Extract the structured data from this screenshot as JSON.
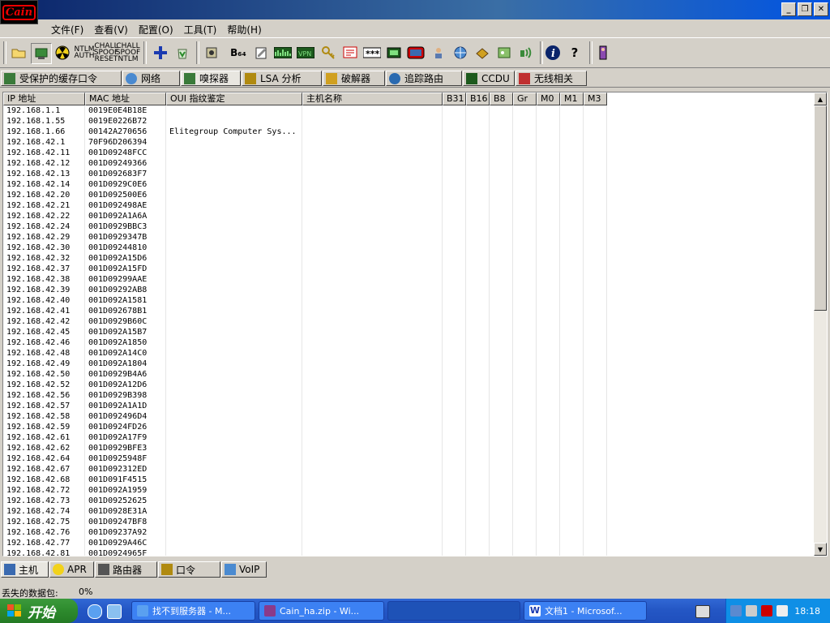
{
  "app": {
    "logo_text": "Cain"
  },
  "window_buttons": {
    "minimize": "_",
    "restore": "❐",
    "close": "✕"
  },
  "menu": [
    "文件(F)",
    "查看(V)",
    "配置(O)",
    "工具(T)",
    "帮助(H)"
  ],
  "toolbar": {
    "b64_label": "B₆₄",
    "ntlm_auth": [
      "NTLM",
      "AUTH"
    ],
    "chall_reset": [
      "CHALL",
      "SPOOF",
      "RESET"
    ],
    "chall_ntlm": [
      "CHALL",
      "SPOOF",
      "NTLM"
    ],
    "password_mask": "***",
    "help_mark": "?"
  },
  "tabs": [
    "受保护的缓存口令",
    "网络",
    "嗅探器",
    "LSA 分析",
    "破解器",
    "追踪路由",
    "CCDU",
    "无线相关"
  ],
  "columns": [
    "IP 地址",
    "MAC 地址",
    "OUI 指纹鉴定",
    "主机名称",
    "B31",
    "B16",
    "B8",
    "Gr",
    "M0",
    "M1",
    "M3"
  ],
  "rows": [
    {
      "ip": "192.168.1.1",
      "mac": "0019E0E4B18E",
      "oui": ""
    },
    {
      "ip": "192.168.1.55",
      "mac": "0019E0226B72",
      "oui": ""
    },
    {
      "ip": "192.168.1.66",
      "mac": "00142A270656",
      "oui": "Elitegroup Computer Sys..."
    },
    {
      "ip": "192.168.42.1",
      "mac": "70F96D206394",
      "oui": ""
    },
    {
      "ip": "192.168.42.11",
      "mac": "001D09248FCC",
      "oui": ""
    },
    {
      "ip": "192.168.42.12",
      "mac": "001D09249366",
      "oui": ""
    },
    {
      "ip": "192.168.42.13",
      "mac": "001D092683F7",
      "oui": ""
    },
    {
      "ip": "192.168.42.14",
      "mac": "001D0929C0E6",
      "oui": ""
    },
    {
      "ip": "192.168.42.20",
      "mac": "001D092500E6",
      "oui": ""
    },
    {
      "ip": "192.168.42.21",
      "mac": "001D092498AE",
      "oui": ""
    },
    {
      "ip": "192.168.42.22",
      "mac": "001D092A1A6A",
      "oui": ""
    },
    {
      "ip": "192.168.42.24",
      "mac": "001D0929BBC3",
      "oui": ""
    },
    {
      "ip": "192.168.42.29",
      "mac": "001D0929347B",
      "oui": ""
    },
    {
      "ip": "192.168.42.30",
      "mac": "001D09244810",
      "oui": ""
    },
    {
      "ip": "192.168.42.32",
      "mac": "001D092A15D6",
      "oui": ""
    },
    {
      "ip": "192.168.42.37",
      "mac": "001D092A15FD",
      "oui": ""
    },
    {
      "ip": "192.168.42.38",
      "mac": "001D09299AAE",
      "oui": ""
    },
    {
      "ip": "192.168.42.39",
      "mac": "001D09292AB8",
      "oui": ""
    },
    {
      "ip": "192.168.42.40",
      "mac": "001D092A1581",
      "oui": ""
    },
    {
      "ip": "192.168.42.41",
      "mac": "001D092678B1",
      "oui": ""
    },
    {
      "ip": "192.168.42.42",
      "mac": "001D0929B60C",
      "oui": ""
    },
    {
      "ip": "192.168.42.45",
      "mac": "001D092A15B7",
      "oui": ""
    },
    {
      "ip": "192.168.42.46",
      "mac": "001D092A1850",
      "oui": ""
    },
    {
      "ip": "192.168.42.48",
      "mac": "001D092A14C0",
      "oui": ""
    },
    {
      "ip": "192.168.42.49",
      "mac": "001D092A1804",
      "oui": ""
    },
    {
      "ip": "192.168.42.50",
      "mac": "001D0929B4A6",
      "oui": ""
    },
    {
      "ip": "192.168.42.52",
      "mac": "001D092A12D6",
      "oui": ""
    },
    {
      "ip": "192.168.42.56",
      "mac": "001D0929B398",
      "oui": ""
    },
    {
      "ip": "192.168.42.57",
      "mac": "001D092A1A1D",
      "oui": ""
    },
    {
      "ip": "192.168.42.58",
      "mac": "001D092496D4",
      "oui": ""
    },
    {
      "ip": "192.168.42.59",
      "mac": "001D0924FD26",
      "oui": ""
    },
    {
      "ip": "192.168.42.61",
      "mac": "001D092A17F9",
      "oui": ""
    },
    {
      "ip": "192.168.42.62",
      "mac": "001D0929BFE3",
      "oui": ""
    },
    {
      "ip": "192.168.42.64",
      "mac": "001D0925948F",
      "oui": ""
    },
    {
      "ip": "192.168.42.67",
      "mac": "001D092312ED",
      "oui": ""
    },
    {
      "ip": "192.168.42.68",
      "mac": "001D091F4515",
      "oui": ""
    },
    {
      "ip": "192.168.42.72",
      "mac": "001D092A1959",
      "oui": ""
    },
    {
      "ip": "192.168.42.73",
      "mac": "001D09252625",
      "oui": ""
    },
    {
      "ip": "192.168.42.74",
      "mac": "001D0928E31A",
      "oui": ""
    },
    {
      "ip": "192.168.42.75",
      "mac": "001D09247BF8",
      "oui": ""
    },
    {
      "ip": "192.168.42.76",
      "mac": "001D09237A92",
      "oui": ""
    },
    {
      "ip": "192.168.42.77",
      "mac": "001D0929A46C",
      "oui": ""
    },
    {
      "ip": "192.168.42.81",
      "mac": "001D0924965F",
      "oui": ""
    }
  ],
  "bottom_tabs": [
    "主机",
    "APR",
    "路由器",
    "口令",
    "VoIP"
  ],
  "status": {
    "label": "丢失的数据包:",
    "value": "0%"
  },
  "taskbar": {
    "start": "开始",
    "tasks": [
      "找不到服务器 - M...",
      "Cain_ha.zip - Wi...",
      "",
      "文档1 - Microsof..."
    ],
    "clock": "18:18"
  },
  "colors": {
    "title_bar": "#0a246a",
    "taskbar": "#2457c5",
    "start": "#2d8a2d",
    "tray": "#0f8fe6"
  }
}
